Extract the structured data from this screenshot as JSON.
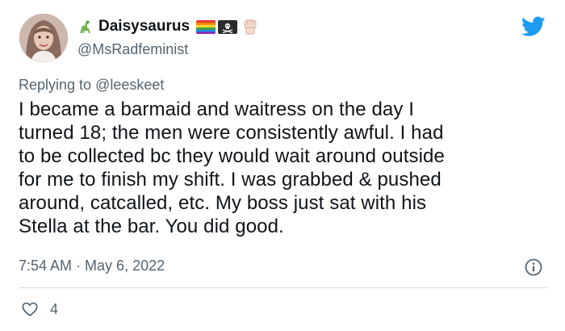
{
  "user": {
    "display_name": "Daisysaurus",
    "handle": "@MsRadfeminist"
  },
  "icons": {
    "name_prefix": "dinosaur-icon",
    "badges": [
      "rainbow-flag-icon",
      "pirate-flag-icon",
      "raised-fist-icon"
    ],
    "app": "twitter-bird-icon",
    "info": "info-icon",
    "like": "heart-icon"
  },
  "reply": {
    "prefix": "Replying to ",
    "target": "@leeskeet"
  },
  "tweet": {
    "text": "I became a barmaid and waitress on the day I\nturned 18; the men were consistently awful. I had\nto be collected bc they would wait around outside\nfor me to finish my shift. I was grabbed & pushed\naround, catcalled, etc. My boss just sat with his\nStella at the bar. You did good.",
    "time": "7:54 AM",
    "separator": " · ",
    "date": "May 6, 2022"
  },
  "stats": {
    "likes": "4"
  },
  "colors": {
    "twitter_blue": "#1d9bf0",
    "muted": "#536471",
    "text": "#0f1419",
    "divider": "#cfd9de"
  }
}
